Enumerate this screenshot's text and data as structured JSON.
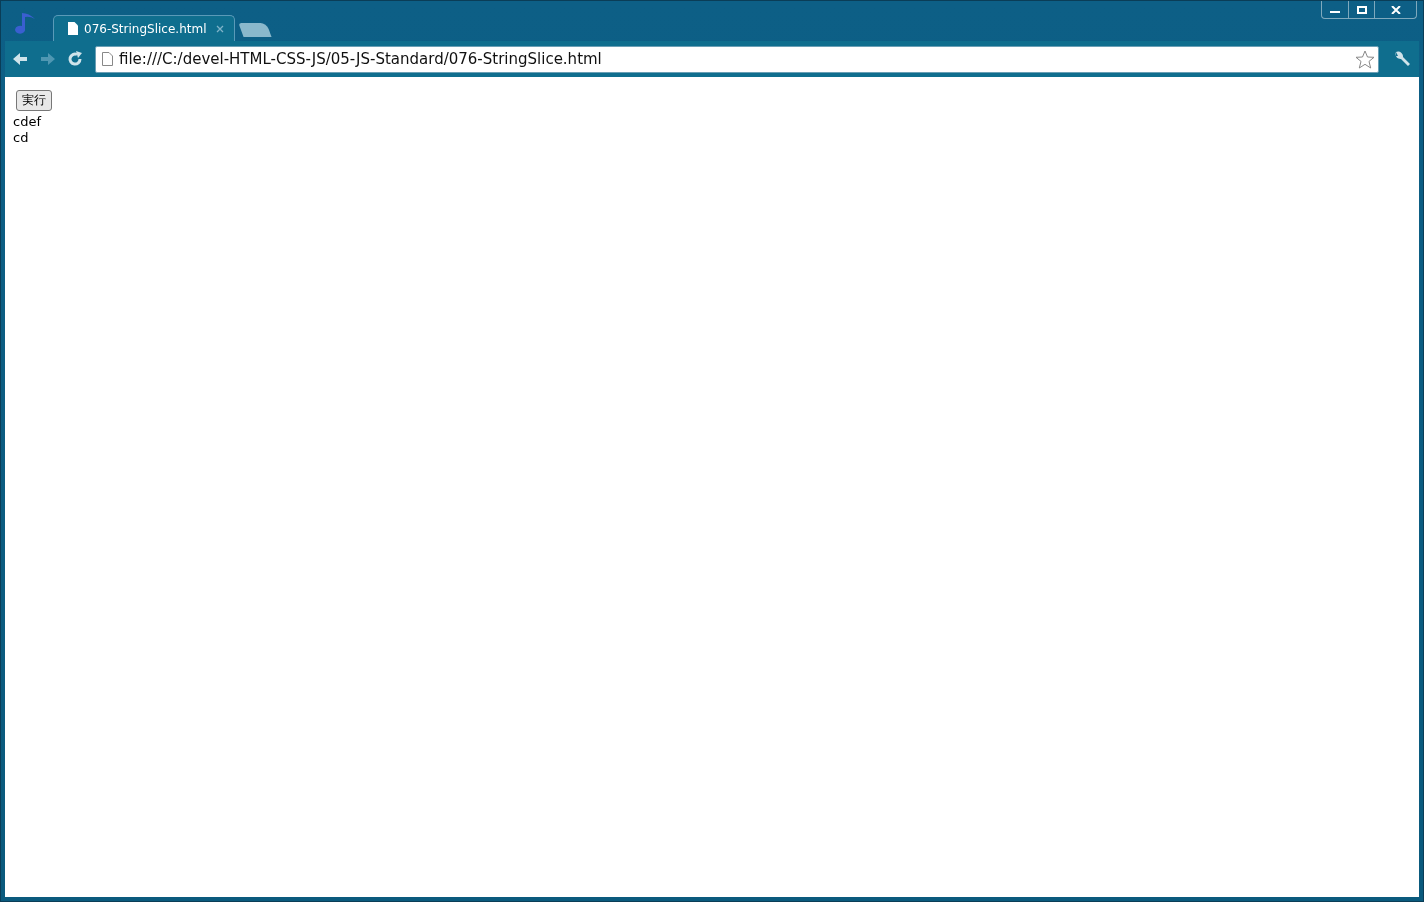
{
  "tabs": [
    {
      "title": "076-StringSlice.html",
      "selected": true
    }
  ],
  "address_bar": {
    "url": "file:///C:/devel-HTML-CSS-JS/05-JS-Standard/076-StringSlice.html"
  },
  "toolbar": {
    "forward_disabled": true
  },
  "page": {
    "button": "実行",
    "output_lines": [
      "cdef",
      "cd"
    ]
  }
}
